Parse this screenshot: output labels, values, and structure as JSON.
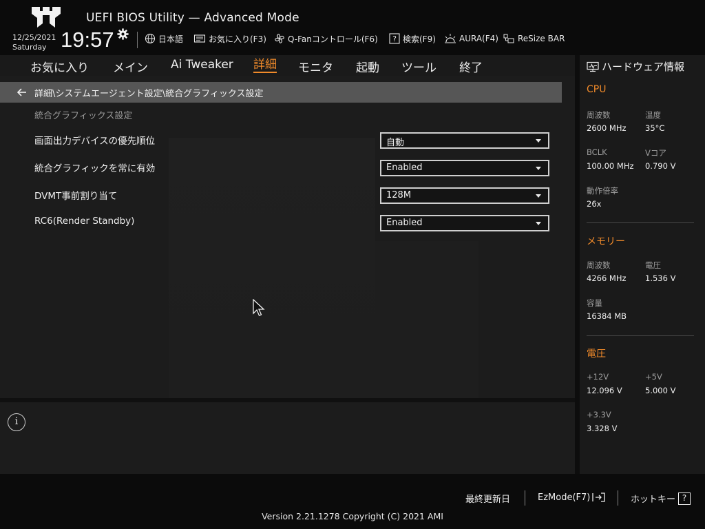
{
  "header": {
    "title": "UEFI BIOS Utility — Advanced Mode",
    "date": "12/25/2021",
    "day": "Saturday",
    "time": "19:57",
    "toolbar": [
      {
        "icon": "globe-icon",
        "label": "日本語"
      },
      {
        "icon": "favorites-icon",
        "label": "お気に入り(F3)"
      },
      {
        "icon": "fan-icon",
        "label": "Q-Fanコントロール(F6)"
      },
      {
        "icon": "help-search-icon",
        "label": "検索(F9)"
      },
      {
        "icon": "aura-icon",
        "label": "AURA(F4)"
      },
      {
        "icon": "resize-bar-icon",
        "label": "ReSize BAR"
      }
    ]
  },
  "menu": {
    "items": [
      "お気に入り",
      "メイン",
      "Ai Tweaker",
      "詳細",
      "モニタ",
      "起動",
      "ツール",
      "終了"
    ],
    "active_index": 3
  },
  "main": {
    "breadcrumb": "詳細\\システムエージェント設定\\統合グラフィックス設定",
    "section_label": "統合グラフィックス設定",
    "settings": [
      {
        "label": "画面出力デバイスの優先順位",
        "value": "自動"
      },
      {
        "label": "統合グラフィックを常に有効",
        "value": "Enabled"
      },
      {
        "label": "DVMT事前割り当て",
        "value": "128M"
      },
      {
        "label": "RC6(Render Standby)",
        "value": "Enabled"
      }
    ]
  },
  "info": {
    "icon": "info-icon",
    "glyph": "i"
  },
  "hardware": {
    "title": "ハードウェア情報",
    "cpu": {
      "heading": "CPU",
      "freq_label": "周波数",
      "freq": "2600 MHz",
      "temp_label": "温度",
      "temp": "35°C",
      "bclk_label": "BCLK",
      "bclk": "100.00 MHz",
      "vcore_label": "Vコア",
      "vcore": "0.790 V",
      "ratio_label": "動作倍率",
      "ratio": "26x"
    },
    "memory": {
      "heading": "メモリー",
      "freq_label": "周波数",
      "freq": "4266 MHz",
      "volt_label": "電圧",
      "volt": "1.536 V",
      "capacity_label": "容量",
      "capacity": "16384 MB"
    },
    "voltage": {
      "heading": "電圧",
      "v12_label": "+12V",
      "v12": "12.096 V",
      "v5_label": "+5V",
      "v5": "5.000 V",
      "v33_label": "+3.3V",
      "v33": "3.328 V"
    }
  },
  "footer": {
    "last_modified": "最終更新日",
    "ezmode": "EzMode(F7)",
    "hotkeys": "ホットキー",
    "hotkeys_glyph": "?",
    "version": "Version 2.21.1278 Copyright (C) 2021 AMI"
  },
  "colors": {
    "accent": "#f08a2a",
    "background": "#1c1c1c",
    "breadcrumb_bar": "#565656"
  }
}
